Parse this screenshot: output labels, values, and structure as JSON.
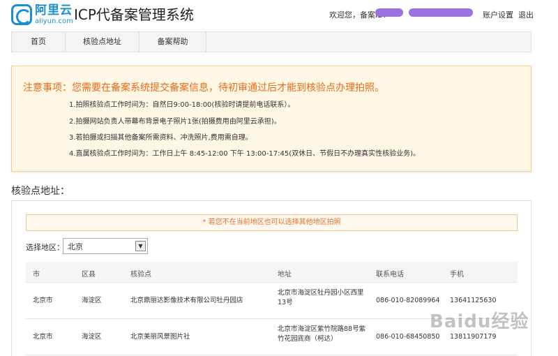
{
  "header": {
    "logo_cn": "阿里云",
    "logo_en": "aliyun.com",
    "title": "ICP代备案管理系统",
    "welcome": "欢迎您，备案ID:",
    "account_settings": "账户设置",
    "logout": "退出"
  },
  "nav": {
    "items": [
      {
        "label": "首页"
      },
      {
        "label": "核验点地址"
      },
      {
        "label": "备案帮助"
      }
    ]
  },
  "notice": {
    "title": "注意事项：您需要在备案系统提交备案信息，待初审通过后才能到核验点办理拍照。",
    "lines": [
      "1.拍照核验点工作时间为：自然日9:00-18:00(核验时请提前电话联系）。",
      "2.拍摄网站负责人带幕布背景电子照片1张(拍摄费用由阿里云承担)。",
      "3.若拍摄或扫描其他备案所需资料、冲洗照片,费用需自理。",
      "4.直属核验点工作时间为：工作日上午 8:45-12:00 下午 13:00-17:45(双休日、节假日不办理真实性核验业务)。"
    ]
  },
  "section": {
    "title": "核验点地址："
  },
  "panel": {
    "tip": "* 若您不在当前地区也可以选择其他地区拍照",
    "region_label": "选择地区：",
    "region_value": "北京"
  },
  "table": {
    "headers": [
      "市",
      "区县",
      "核验点",
      "地址",
      "联系电话",
      "手机"
    ],
    "rows": [
      {
        "city": "北京市",
        "district": "海淀区",
        "point": "北京鼎丽达影像技术有限公司牡丹园店",
        "address": "北京市海淀区牡丹园小区西里13号",
        "phone": "086-010-82089964",
        "mobile": "13641125630"
      },
      {
        "city": "北京市",
        "district": "海淀区",
        "point": "北京美丽风景图片社",
        "address": "北京市海淀区紫竹院路88号紫竹花园底商（柯达）",
        "phone": "086-010-68450850",
        "mobile": "13811907179"
      }
    ]
  },
  "watermark": "Baidu经验"
}
